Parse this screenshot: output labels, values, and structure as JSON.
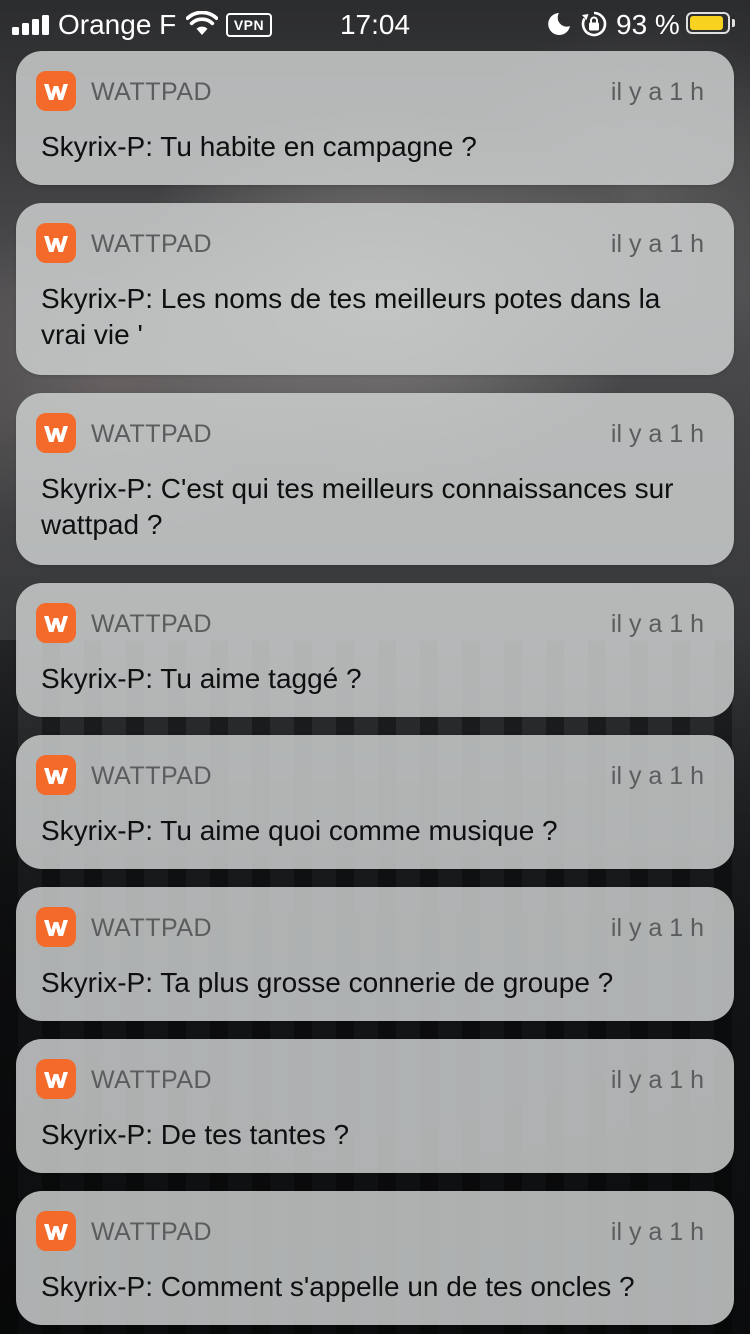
{
  "status_bar": {
    "carrier": "Orange F",
    "vpn_label": "VPN",
    "time": "17:04",
    "battery_percent_text": "93 %",
    "battery_level": 0.93,
    "battery_color": "#f7d320",
    "icons": [
      "signal-icon",
      "wifi-icon",
      "moon-icon",
      "rotation-lock-icon",
      "battery-icon"
    ]
  },
  "notifications": [
    {
      "app": "WATTPAD",
      "time": "il y a 1 h",
      "message": "Skyrix-P: Tu habite en campagne ?"
    },
    {
      "app": "WATTPAD",
      "time": "il y a 1 h",
      "message": "Skyrix-P: Les noms de tes meilleurs potes dans la vrai vie '"
    },
    {
      "app": "WATTPAD",
      "time": "il y a 1 h",
      "message": "Skyrix-P: C'est qui tes meilleurs connaissances sur wattpad ?"
    },
    {
      "app": "WATTPAD",
      "time": "il y a 1 h",
      "message": "Skyrix-P: Tu aime taggé ?"
    },
    {
      "app": "WATTPAD",
      "time": "il y a 1 h",
      "message": "Skyrix-P: Tu aime quoi comme musique ?"
    },
    {
      "app": "WATTPAD",
      "time": "il y a 1 h",
      "message": "Skyrix-P: Ta plus grosse connerie de groupe ?"
    },
    {
      "app": "WATTPAD",
      "time": "il y a 1 h",
      "message": "Skyrix-P: De tes tantes ?"
    },
    {
      "app": "WATTPAD",
      "time": "il y a 1 h",
      "message": "Skyrix-P: Comment s'appelle un de tes oncles ?"
    }
  ],
  "colors": {
    "wattpad_orange": "#f36a2a"
  }
}
